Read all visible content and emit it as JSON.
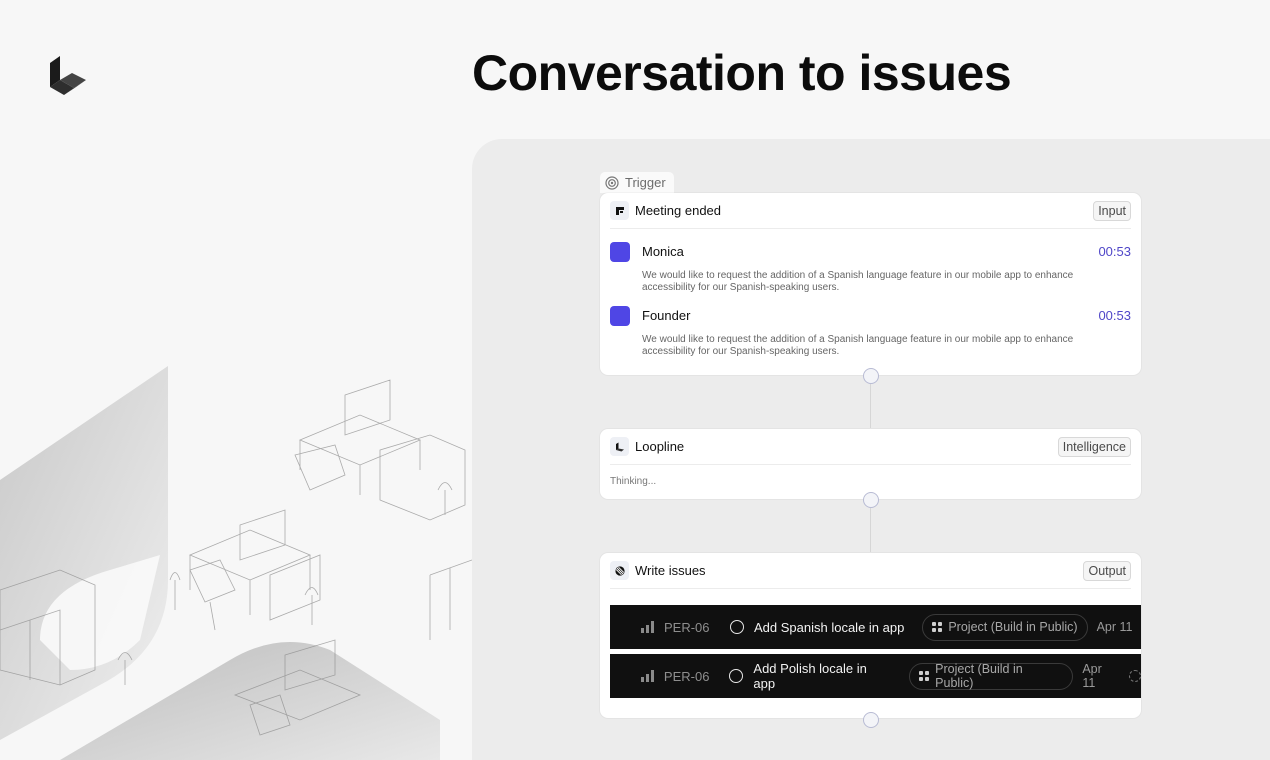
{
  "headline": "Conversation to issues",
  "icons": {
    "brand": "loopline-logo",
    "trigger": "target-icon",
    "meeting_app": "meeting-app-icon",
    "loopline_app": "loopline-icon",
    "issues_app": "issue-tracker-icon",
    "priority": "priority-bars-icon",
    "status": "todo-circle-icon",
    "project": "project-grid-icon",
    "assignee": "assignee-icon"
  },
  "colors": {
    "avatar": "#4f46e5",
    "timestamp": "#4f46c8",
    "issue_row_bg": "#101010"
  },
  "trigger": {
    "label": "Trigger",
    "card_title": "Meeting ended",
    "badge": "Input",
    "messages": [
      {
        "name": "Monica",
        "time": "00:53",
        "text": "We would like to request the addition of a Spanish language feature in our mobile app to enhance accessibility for our Spanish-speaking users."
      },
      {
        "name": "Founder",
        "time": "00:53",
        "text": "We would like to request the addition of a Spanish language feature in our mobile app to enhance accessibility for our Spanish-speaking users."
      }
    ]
  },
  "intelligence": {
    "card_title": "Loopline",
    "badge": "Intelligence",
    "status": "Thinking..."
  },
  "output": {
    "card_title": "Write issues",
    "badge": "Output",
    "issues": [
      {
        "id": "PER-06",
        "title": "Add Spanish locale in app",
        "project": "Project (Build in Public)",
        "date": "Apr 11"
      },
      {
        "id": "PER-06",
        "title": "Add Polish locale in app",
        "project": "Project (Build in Public)",
        "date": "Apr 11"
      }
    ]
  }
}
